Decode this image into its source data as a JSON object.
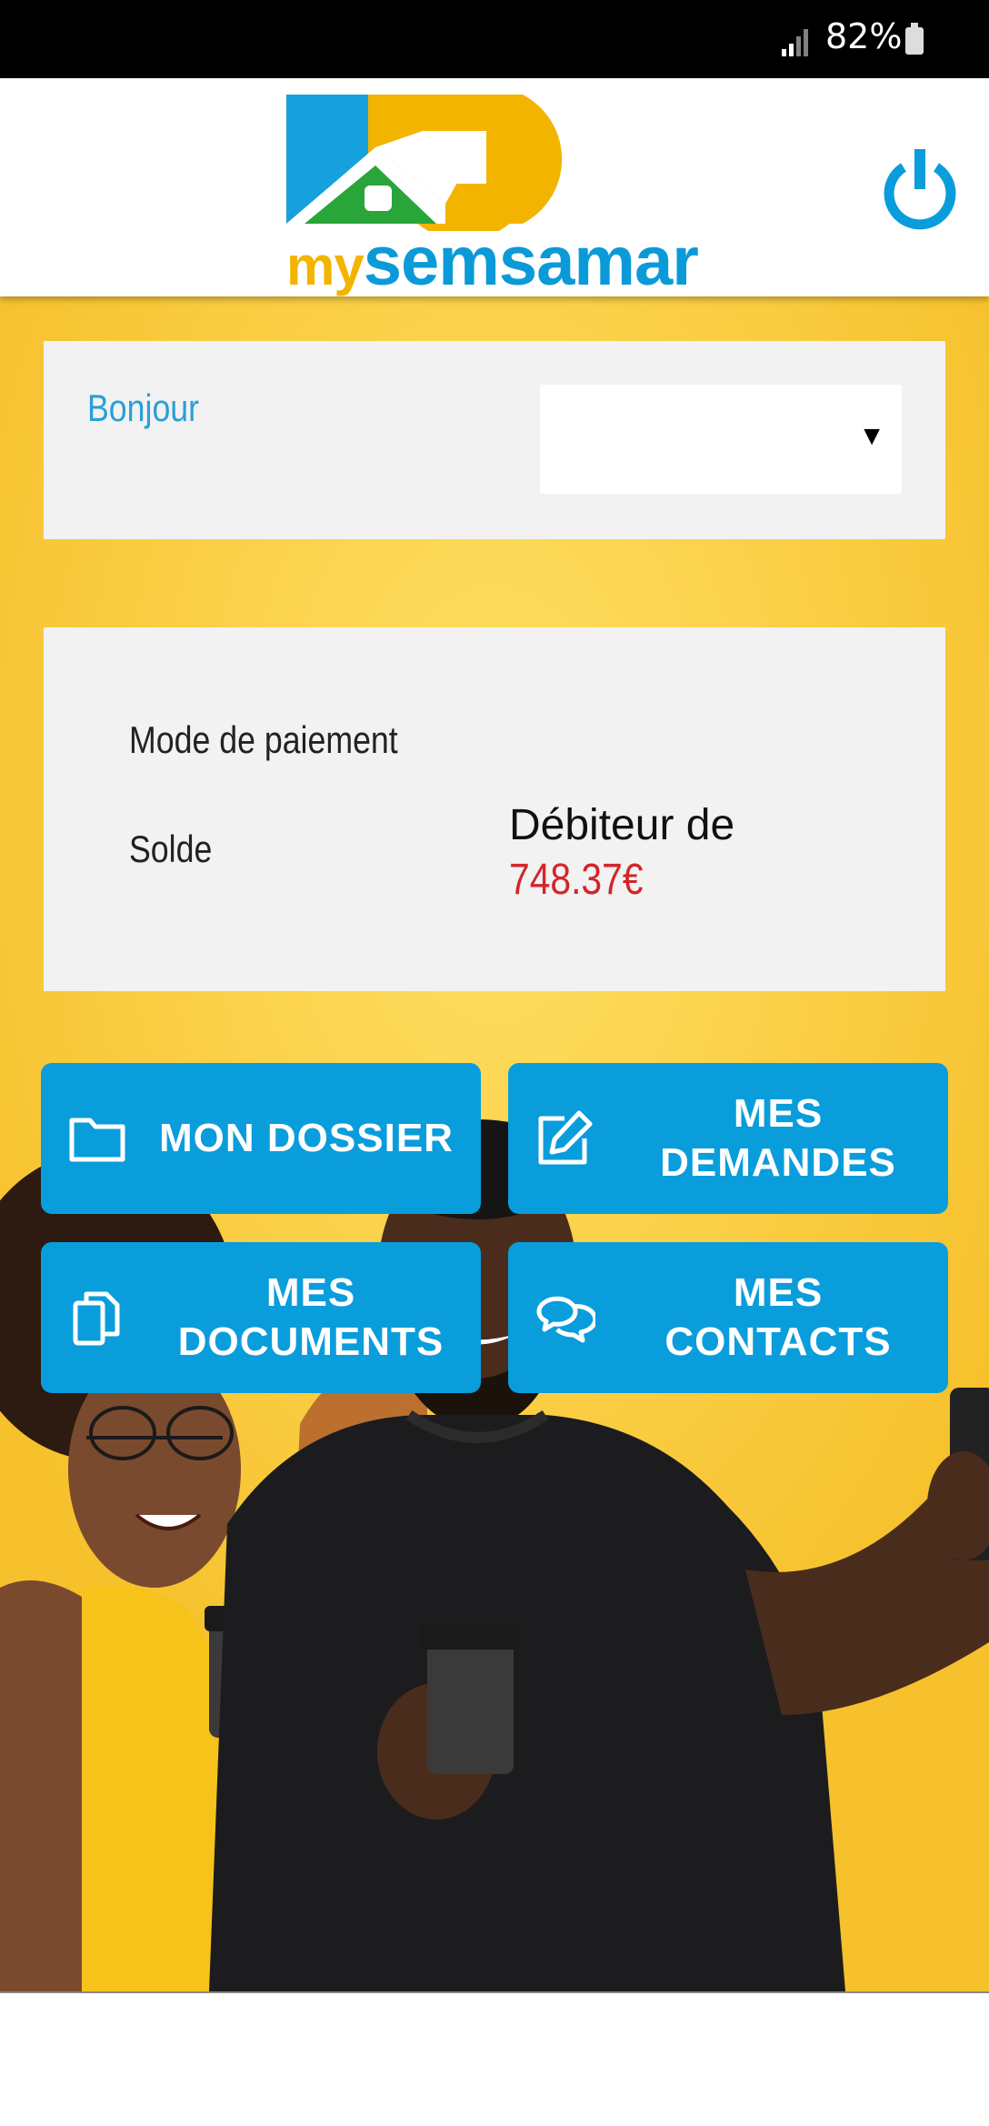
{
  "status_bar": {
    "battery": "82%"
  },
  "header": {
    "logo_prefix": "my",
    "logo_brand": "semsamar",
    "power_icon": "power-icon"
  },
  "greeting": {
    "label": "Bonjour",
    "select_value": "",
    "select_icon": "dropdown-arrow-icon"
  },
  "account": {
    "payment_mode_label": "Mode de paiement",
    "balance_label": "Solde",
    "balance_status": "Débiteur de",
    "balance_amount": "748.37€"
  },
  "actions": [
    {
      "label": "MON DOSSIER",
      "icon": "folder-icon"
    },
    {
      "label": "MES DEMANDES",
      "icon": "edit-icon"
    },
    {
      "label": "MES DOCUMENTS",
      "icon": "documents-icon"
    },
    {
      "label": "MES CONTACTS",
      "icon": "chat-icon"
    }
  ],
  "colors": {
    "brand_blue": "#0a9ddc",
    "brand_yellow": "#f3b400",
    "amount_red": "#d3262b",
    "background_yellow": "#fdd23c"
  }
}
